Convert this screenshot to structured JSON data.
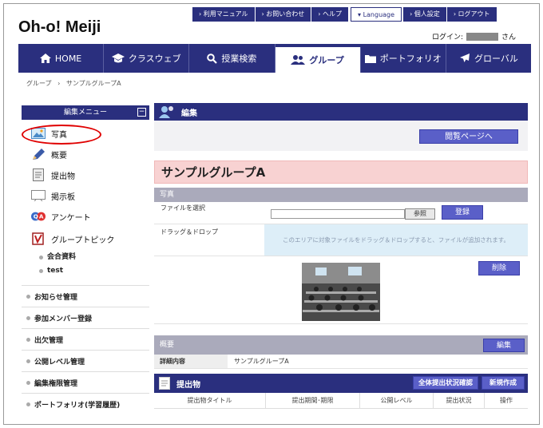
{
  "logo": "Oh-o! Meiji",
  "topnav": [
    "› 利用マニュアル",
    "› お問い合わせ",
    "› ヘルプ",
    "▾ Language",
    "› 個人設定",
    "› ログアウト"
  ],
  "login": {
    "label": "ログイン:",
    "suffix": "さん"
  },
  "mainnav": [
    {
      "label": "HOME",
      "icon": "home-icon"
    },
    {
      "label": "クラスウェブ",
      "icon": "mortarboard-icon"
    },
    {
      "label": "授業検索",
      "icon": "search-icon"
    },
    {
      "label": "グループ",
      "icon": "group-icon"
    },
    {
      "label": "ポートフォリオ",
      "icon": "folder-icon"
    },
    {
      "label": "グローバル",
      "icon": "airplane-icon"
    }
  ],
  "breadcrumb": {
    "root": "グループ",
    "sep": "›",
    "current": "サンプルグループA"
  },
  "sidebar": {
    "header": "編集メニュー",
    "collapse": "−",
    "items": [
      {
        "label": "写真",
        "icon": "photo-icon"
      },
      {
        "label": "概要",
        "icon": "pencil-icon"
      },
      {
        "label": "提出物",
        "icon": "document-icon"
      },
      {
        "label": "掲示板",
        "icon": "board-icon"
      },
      {
        "label": "アンケート",
        "icon": "qa-icon"
      },
      {
        "label": "グループトピック",
        "icon": "topic-book-icon"
      }
    ],
    "subitems": [
      "会合資料",
      "test"
    ],
    "links": [
      "お知らせ管理",
      "参加メンバー登録",
      "出欠管理",
      "公開レベル管理",
      "編集権限管理",
      "ポートフォリオ(学習履歴)"
    ]
  },
  "main": {
    "header": "編集",
    "view_button": "閲覧ページへ",
    "group_title": "サンプルグループA",
    "photo": {
      "section": "写真",
      "file_label": "ファイルを選択",
      "browse": "参照",
      "register": "登録",
      "dd_label": "ドラッグ＆ドロップ",
      "dd_text": "このエリアに対象ファイルをドラッグ＆ドロップすると、ファイルが追加されます。",
      "delete": "削除"
    },
    "summary": {
      "section": "概要",
      "edit": "編集",
      "detail_label": "詳細内容",
      "detail_value": "サンプルグループA"
    },
    "submission": {
      "header": "提出物",
      "check_all": "全体提出状況確認",
      "new": "新規作成",
      "columns": [
        "提出物タイトル",
        "提出期間･期限",
        "公開レベル",
        "提出状況",
        "操作"
      ]
    }
  }
}
